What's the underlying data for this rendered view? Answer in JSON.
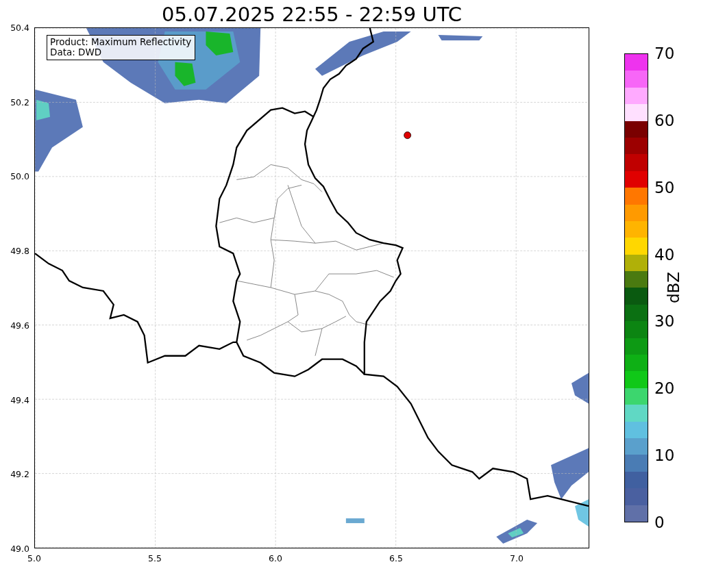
{
  "title": "05.07.2025 22:55 - 22:59 UTC",
  "annotation": {
    "lines": [
      "Product: Maximum Reflectivity",
      "Data: DWD"
    ]
  },
  "x_ticks": [
    "5.0",
    "5.5",
    "6.0",
    "6.5",
    "7.0"
  ],
  "y_ticks": [
    "50.4",
    "50.2",
    "50.0",
    "49.8",
    "49.6",
    "49.4",
    "49.2",
    "49.0"
  ],
  "colorbar": {
    "label": "dBZ",
    "ticks": [
      "70",
      "60",
      "50",
      "40",
      "30",
      "20",
      "10",
      "0"
    ],
    "bands": [
      {
        "color": "#ee33ee"
      },
      {
        "color": "#f766f7"
      },
      {
        "color": "#ffaaff"
      },
      {
        "color": "#ffe0ff"
      },
      {
        "color": "#7a0000"
      },
      {
        "color": "#9c0000"
      },
      {
        "color": "#c00000"
      },
      {
        "color": "#e00000"
      },
      {
        "color": "#ff7700"
      },
      {
        "color": "#ff9a00"
      },
      {
        "color": "#ffb400"
      },
      {
        "color": "#ffd700"
      },
      {
        "color": "#b0b008"
      },
      {
        "color": "#4a7a10"
      },
      {
        "color": "#0a5a10"
      },
      {
        "color": "#0b7012"
      },
      {
        "color": "#0c8512"
      },
      {
        "color": "#0d9a14"
      },
      {
        "color": "#0eb015"
      },
      {
        "color": "#10c818"
      },
      {
        "color": "#3cd66e"
      },
      {
        "color": "#60d8c4"
      },
      {
        "color": "#60c0e0"
      },
      {
        "color": "#5aa0cc"
      },
      {
        "color": "#4a7cb4"
      },
      {
        "color": "#4060a0"
      },
      {
        "color": "#4a60a0"
      },
      {
        "color": "#6070a8"
      }
    ]
  }
}
